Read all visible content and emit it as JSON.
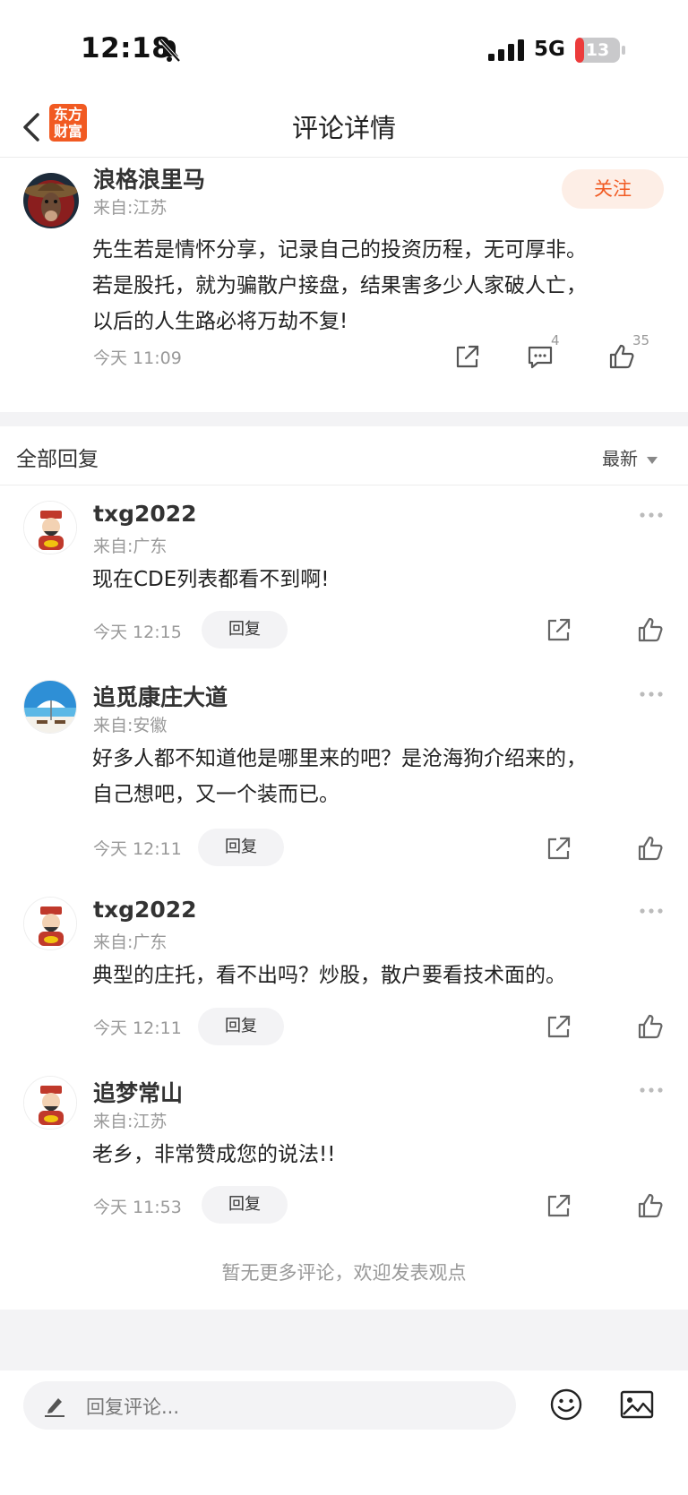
{
  "status_bar": {
    "time": "12:18",
    "network": "5G",
    "battery": "13"
  },
  "nav": {
    "title": "评论详情",
    "logo_line1": "东方",
    "logo_line2": "财富"
  },
  "main_comment": {
    "username": "浪格浪里马",
    "location": "来自:江苏",
    "follow_label": "关注",
    "text_lines": [
      "先生若是情怀分享，记录自己的投资历程，无可厚非。",
      "若是股托，就为骗散户接盘，结果害多少人家破人亡，",
      "以后的人生路必将万劫不复!"
    ],
    "time": "今天 11:09",
    "comment_count": "4",
    "like_count": "35"
  },
  "replies_header": {
    "title": "全部回复",
    "sort": "最新"
  },
  "replies": [
    {
      "username": "txg2022",
      "location": "来自:广东",
      "text_lines": [
        "现在CDE列表都看不到啊!"
      ],
      "time": "今天 12:15",
      "reply_label": "回复"
    },
    {
      "username": "追觅康庄大道",
      "location": "来自:安徽",
      "text_lines": [
        "好多人都不知道他是哪里来的吧？是沧海狗介绍来的，",
        "自己想吧，又一个装而已。"
      ],
      "time": "今天 12:11",
      "reply_label": "回复"
    },
    {
      "username": "txg2022",
      "location": "来自:广东",
      "text_lines": [
        "典型的庄托，看不出吗？炒股，散户要看技术面的。"
      ],
      "time": "今天 12:11",
      "reply_label": "回复"
    },
    {
      "username": "追梦常山",
      "location": "来自:江苏",
      "text_lines": [
        "老乡，非常赞成您的说法!!"
      ],
      "time": "今天 11:53",
      "reply_label": "回复"
    }
  ],
  "no_more_text": "暂无更多评论，欢迎发表观点",
  "input": {
    "placeholder": "回复评论..."
  },
  "colors": {
    "accent": "#f15a22",
    "follow_bg": "#fdeee6",
    "muted": "#999999",
    "band": "#f3f3f5"
  }
}
